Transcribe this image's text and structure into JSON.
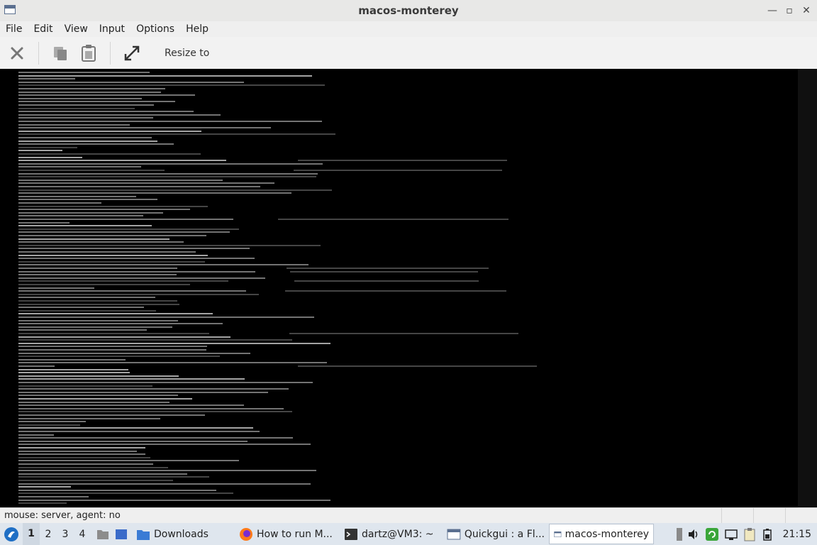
{
  "window": {
    "title": "macos-monterey"
  },
  "menu": [
    "File",
    "Edit",
    "View",
    "Input",
    "Options",
    "Help"
  ],
  "toolbar": {
    "resize_label": "Resize to"
  },
  "status": {
    "text": "mouse: server, agent:  no"
  },
  "taskbar": {
    "workspaces": [
      "1",
      "2",
      "3",
      "4"
    ],
    "tasks": [
      {
        "label": "Downloads",
        "icon": "folder-icon"
      },
      {
        "label": "How to run M...",
        "icon": "firefox-icon"
      },
      {
        "label": "dartz@VM3: ~",
        "icon": "terminal-icon"
      },
      {
        "label": "Quickgui : a Fl...",
        "icon": "window-icon"
      },
      {
        "label": "macos-monterey",
        "icon": "window-icon",
        "active": true
      }
    ],
    "clock": "21:15"
  },
  "colors": {
    "console_bg": "#000000",
    "console_text": "#9a9a9a",
    "chrome": "#efefef",
    "taskbar": "#dfe6ee"
  }
}
